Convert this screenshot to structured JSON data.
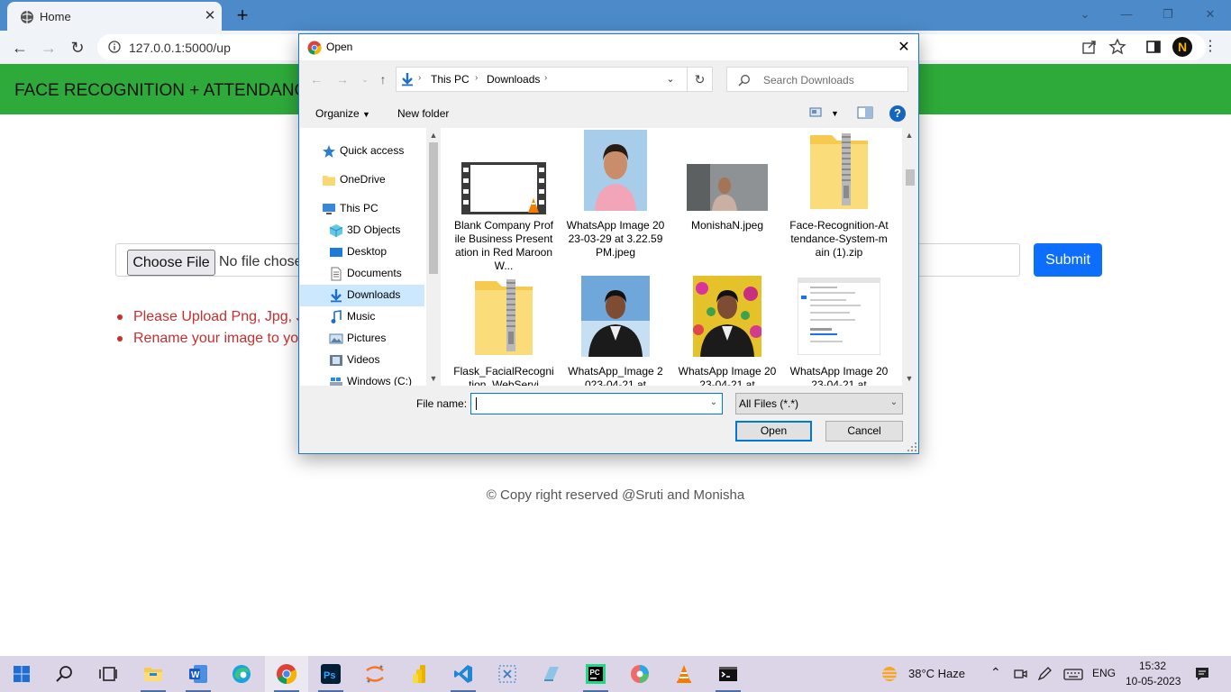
{
  "browser": {
    "tab_title": "Home",
    "url": "127.0.0.1:5000/up",
    "profile_initial": "N"
  },
  "page": {
    "brand": "FACE RECOGNITION + ATTENDANCE",
    "choose_file_label": "Choose File",
    "no_file_text": "No file chosen",
    "submit_label": "Submit",
    "rules": [
      "Please Upload Png, Jpg, Jpeg",
      "Rename your image to your name"
    ],
    "footer": "© Copy right reserved @Sruti and Monisha",
    "accent": "#2eaa3a"
  },
  "dialog": {
    "title": "Open",
    "breadcrumb": [
      "This PC",
      "Downloads"
    ],
    "search_placeholder": "Search Downloads",
    "organize_label": "Organize",
    "new_folder_label": "New folder",
    "nav_items": [
      {
        "label": "Quick access",
        "icon": "star-icon"
      },
      {
        "label": "OneDrive",
        "icon": "folder-icon"
      },
      {
        "label": "This PC",
        "icon": "computer-icon"
      },
      {
        "label": "3D Objects",
        "icon": "cube-icon"
      },
      {
        "label": "Desktop",
        "icon": "desktop-icon"
      },
      {
        "label": "Documents",
        "icon": "document-icon"
      },
      {
        "label": "Downloads",
        "icon": "download-icon",
        "selected": true
      },
      {
        "label": "Music",
        "icon": "music-icon"
      },
      {
        "label": "Pictures",
        "icon": "pictures-icon"
      },
      {
        "label": "Videos",
        "icon": "videos-icon"
      },
      {
        "label": "Windows (C:)",
        "icon": "drive-icon"
      }
    ],
    "files": [
      {
        "name": "Blank Company Profile Business Presentation in Red Maroon W...",
        "kind": "video"
      },
      {
        "name": "WhatsApp Image 2023-03-29 at 3.22.59 PM.jpeg",
        "kind": "photo-woman"
      },
      {
        "name": "MonishaN.jpeg",
        "kind": "photo-webcam"
      },
      {
        "name": "Face-Recognition-Attendance-System-main (1).zip",
        "kind": "zip"
      },
      {
        "name": "Flask_FacialRecognition_WebServi",
        "kind": "zip"
      },
      {
        "name": "WhatsApp_Image 2023-04-21 at",
        "kind": "photo-man-sky"
      },
      {
        "name": "WhatsApp Image 2023-04-21 at",
        "kind": "photo-man-flowers"
      },
      {
        "name": "WhatsApp Image 2023-04-21 at",
        "kind": "screenshot"
      }
    ],
    "file_name_label": "File name:",
    "file_name_value": "",
    "filter": "All Files (*.*)",
    "open_label": "Open",
    "cancel_label": "Cancel"
  },
  "taskbar": {
    "apps": [
      "windows-start",
      "search",
      "task-view",
      "file-explorer",
      "word",
      "edge",
      "chrome",
      "photoshop",
      "jupyter",
      "power-bi",
      "vscode",
      "snipping",
      "notepad-plus",
      "pycharm",
      "paint",
      "vlc",
      "terminal"
    ],
    "weather": "38°C  Haze",
    "language": "ENG",
    "time": "15:32",
    "date": "10-05-2023"
  }
}
